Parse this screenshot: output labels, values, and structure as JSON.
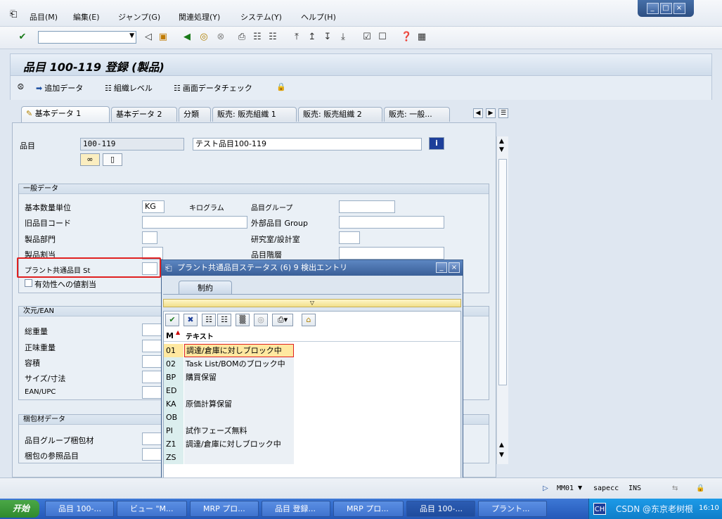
{
  "menu": [
    "品目(M)",
    "編集(E)",
    "ジャンプ(G)",
    "関連処理(Y)",
    "システム(Y)",
    "ヘルプ(H)"
  ],
  "window_controls": [
    "_",
    "□",
    "×"
  ],
  "toolbar": {
    "command_value": ""
  },
  "title": "品目 100-119 登録 (製品)",
  "app_toolbar": {
    "add_data": "追加データ",
    "org_level": "組織レベル",
    "screen_check": "画面データチェック"
  },
  "tabs": [
    "基本データ 1",
    "基本データ 2",
    "分類",
    "販売: 販売組織 1",
    "販売: 販売組織 2",
    "販売: 一般..."
  ],
  "header": {
    "material_label": "品目",
    "material_value": "100-119",
    "description_value": "テスト品目100-119"
  },
  "general": {
    "title": "一般データ",
    "base_uom_label": "基本数量単位",
    "base_uom_value": "KG",
    "base_uom_text": "キログラム",
    "material_group_label": "品目グループ",
    "old_material_label": "旧品目コード",
    "ext_material_group_label": "外部品目 Group",
    "division_label": "製品部門",
    "lab_office_label": "研究室/設計室",
    "product_alloc_label": "製品割当",
    "product_hierarchy_label": "品目階層",
    "plant_status_label": "プラント共通品目 St",
    "valid_from_label": "有効性への値割当"
  },
  "dimensions": {
    "title": "次元/EAN",
    "gross_weight": "総重量",
    "net_weight": "正味重量",
    "volume": "容積",
    "size_dim": "サイズ/寸法",
    "ean_upc": "EAN/UPC"
  },
  "packaging": {
    "title": "梱包材データ",
    "mat_group_pack": "品目グループ梱包材",
    "ref_material": "梱包の参照品目"
  },
  "popup": {
    "title": "プラント共通品目ステータス (6)   9 検出エントリ",
    "tab": "制約",
    "col_code": "M",
    "col_text": "テキスト",
    "rows": [
      {
        "code": "01",
        "text": "調達/倉庫に対しブロック中"
      },
      {
        "code": "02",
        "text": "Task List/BOMのブロック中"
      },
      {
        "code": "BP",
        "text": "購買保留"
      },
      {
        "code": "ED",
        "text": ""
      },
      {
        "code": "KA",
        "text": "原価計算保留"
      },
      {
        "code": "OB",
        "text": ""
      },
      {
        "code": "PI",
        "text": "試作フェーズ無料"
      },
      {
        "code": "Z1",
        "text": "調達/倉庫に対しブロック中"
      },
      {
        "code": "ZS",
        "text": ""
      }
    ]
  },
  "status_bar": {
    "tcode": "MM01",
    "server": "sapecc",
    "mode": "INS"
  },
  "taskbar": {
    "start": "开始",
    "tasks": [
      "品目 100-...",
      "ビュー \"M...",
      "MRP プロ...",
      "品目 登録...",
      "MRP プロ...",
      "品目 100-...",
      "プラント..."
    ],
    "tray_lang": "CH",
    "tray_time": "16:10",
    "watermark": "CSDN @东京老树根"
  },
  "colors": {
    "accent": "#3a5f97",
    "highlight_box": "#e02020",
    "selected_row": "#ffe8a0"
  }
}
